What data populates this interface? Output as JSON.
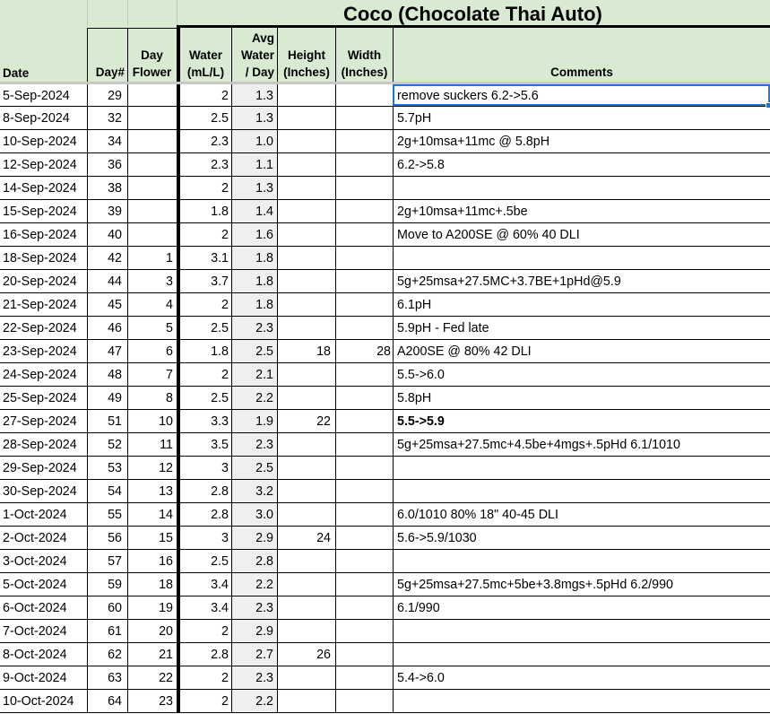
{
  "sheet": {
    "title": "Coco (Chocolate Thai Auto)",
    "headers": {
      "date": "Date",
      "day": "Day#",
      "day_flower": [
        "Day",
        "Flower"
      ],
      "water": [
        "Water",
        "(mL/L)"
      ],
      "avg_water": [
        "Avg",
        "Water",
        "/ Day"
      ],
      "height": [
        "Height",
        "(Inches)"
      ],
      "width": [
        "Width",
        "(Inches)"
      ],
      "comments": "Comments"
    },
    "rows": [
      {
        "date": "5-Sep-2024",
        "day": "29",
        "flower": "",
        "water": "2",
        "avg": "1.3",
        "height": "",
        "width": "",
        "comment": "remove suckers 6.2->5.6"
      },
      {
        "date": "8-Sep-2024",
        "day": "32",
        "flower": "",
        "water": "2.5",
        "avg": "1.3",
        "height": "",
        "width": "",
        "comment": "5.7pH"
      },
      {
        "date": "10-Sep-2024",
        "day": "34",
        "flower": "",
        "water": "2.3",
        "avg": "1.0",
        "height": "",
        "width": "",
        "comment": "2g+10msa+11mc @ 5.8pH"
      },
      {
        "date": "12-Sep-2024",
        "day": "36",
        "flower": "",
        "water": "2.3",
        "avg": "1.1",
        "height": "",
        "width": "",
        "comment": "6.2->5.8"
      },
      {
        "date": "14-Sep-2024",
        "day": "38",
        "flower": "",
        "water": "2",
        "avg": "1.3",
        "height": "",
        "width": "",
        "comment": ""
      },
      {
        "date": "15-Sep-2024",
        "day": "39",
        "flower": "",
        "water": "1.8",
        "avg": "1.4",
        "height": "",
        "width": "",
        "comment": "2g+10msa+11mc+.5be"
      },
      {
        "date": "16-Sep-2024",
        "day": "40",
        "flower": "",
        "water": "2",
        "avg": "1.6",
        "height": "",
        "width": "",
        "comment": "Move to A200SE @ 60% 40 DLI"
      },
      {
        "date": "18-Sep-2024",
        "day": "42",
        "flower": "1",
        "water": "3.1",
        "avg": "1.8",
        "height": "",
        "width": "",
        "comment": ""
      },
      {
        "date": "20-Sep-2024",
        "day": "44",
        "flower": "3",
        "water": "3.7",
        "avg": "1.8",
        "height": "",
        "width": "",
        "comment": "5g+25msa+27.5MC+3.7BE+1pHd@5.9"
      },
      {
        "date": "21-Sep-2024",
        "day": "45",
        "flower": "4",
        "water": "2",
        "avg": "1.8",
        "height": "",
        "width": "",
        "comment": "6.1pH"
      },
      {
        "date": "22-Sep-2024",
        "day": "46",
        "flower": "5",
        "water": "2.5",
        "avg": "2.3",
        "height": "",
        "width": "",
        "comment": "5.9pH - Fed late"
      },
      {
        "date": "23-Sep-2024",
        "day": "47",
        "flower": "6",
        "water": "1.8",
        "avg": "2.5",
        "height": "18",
        "width": "28",
        "comment": "A200SE @ 80% 42 DLI"
      },
      {
        "date": "24-Sep-2024",
        "day": "48",
        "flower": "7",
        "water": "2",
        "avg": "2.1",
        "height": "",
        "width": "",
        "comment": "5.5->6.0"
      },
      {
        "date": "25-Sep-2024",
        "day": "49",
        "flower": "8",
        "water": "2.5",
        "avg": "2.2",
        "height": "",
        "width": "",
        "comment": "5.8pH"
      },
      {
        "date": "27-Sep-2024",
        "day": "51",
        "flower": "10",
        "water": "3.3",
        "avg": "1.9",
        "height": "22",
        "width": "",
        "comment": "5.5->5.9",
        "comment_bold": true
      },
      {
        "date": "28-Sep-2024",
        "day": "52",
        "flower": "11",
        "water": "3.5",
        "avg": "2.3",
        "height": "",
        "width": "",
        "comment": "5g+25msa+27.5mc+4.5be+4mgs+.5pHd 6.1/1010"
      },
      {
        "date": "29-Sep-2024",
        "day": "53",
        "flower": "12",
        "water": "3",
        "avg": "2.5",
        "height": "",
        "width": "",
        "comment": ""
      },
      {
        "date": "30-Sep-2024",
        "day": "54",
        "flower": "13",
        "water": "2.8",
        "avg": "3.2",
        "height": "",
        "width": "",
        "comment": ""
      },
      {
        "date": "1-Oct-2024",
        "day": "55",
        "flower": "14",
        "water": "2.8",
        "avg": "3.0",
        "height": "",
        "width": "",
        "comment": "6.0/1010  80% 18\" 40-45 DLI"
      },
      {
        "date": "2-Oct-2024",
        "day": "56",
        "flower": "15",
        "water": "3",
        "avg": "2.9",
        "height": "24",
        "width": "",
        "comment": "5.6->5.9/1030"
      },
      {
        "date": "3-Oct-2024",
        "day": "57",
        "flower": "16",
        "water": "2.5",
        "avg": "2.8",
        "height": "",
        "width": "",
        "comment": ""
      },
      {
        "date": "5-Oct-2024",
        "day": "59",
        "flower": "18",
        "water": "3.4",
        "avg": "2.2",
        "height": "",
        "width": "",
        "comment": "5g+25msa+27.5mc+5be+3.8mgs+.5pHd 6.2/990"
      },
      {
        "date": "6-Oct-2024",
        "day": "60",
        "flower": "19",
        "water": "3.4",
        "avg": "2.3",
        "height": "",
        "width": "",
        "comment": "6.1/990"
      },
      {
        "date": "7-Oct-2024",
        "day": "61",
        "flower": "20",
        "water": "2",
        "avg": "2.9",
        "height": "",
        "width": "",
        "comment": ""
      },
      {
        "date": "8-Oct-2024",
        "day": "62",
        "flower": "21",
        "water": "2.8",
        "avg": "2.7",
        "height": "26",
        "width": "",
        "comment": ""
      },
      {
        "date": "9-Oct-2024",
        "day": "63",
        "flower": "22",
        "water": "2",
        "avg": "2.3",
        "height": "",
        "width": "",
        "comment": "5.4->6.0"
      },
      {
        "date": "10-Oct-2024",
        "day": "64",
        "flower": "23",
        "water": "2",
        "avg": "2.2",
        "height": "",
        "width": "",
        "comment": ""
      }
    ],
    "selected_row": 0,
    "colors": {
      "header_bg": "#d9ead3",
      "avg_col_bg": "#efefef",
      "selection": "#1a73e8"
    }
  }
}
